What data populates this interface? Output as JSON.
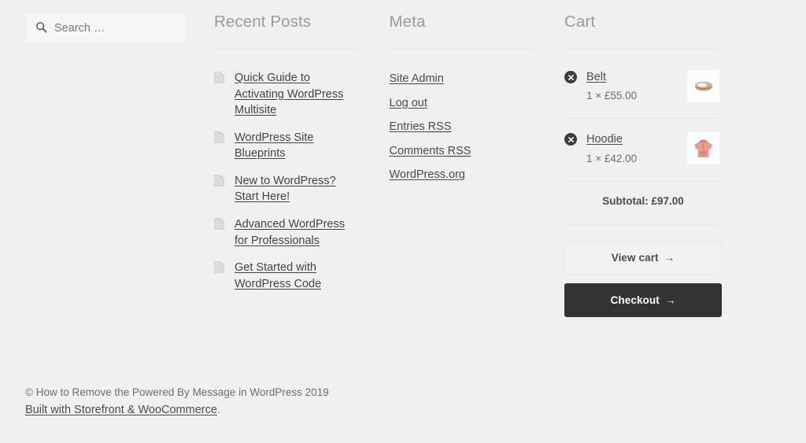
{
  "search": {
    "placeholder": "Search …",
    "value": "",
    "icon": "search-icon"
  },
  "columns": {
    "recent_posts": {
      "title": "Recent Posts",
      "items": [
        {
          "label": "Quick Guide to Activating WordPress Multisite",
          "icon": "document-icon"
        },
        {
          "label": "WordPress Site Blueprints",
          "icon": "document-icon"
        },
        {
          "label": "New to WordPress? Start Here!",
          "icon": "document-icon"
        },
        {
          "label": "Advanced WordPress for Professionals",
          "icon": "document-icon"
        },
        {
          "label": "Get Started with WordPress Code",
          "icon": "document-icon"
        }
      ]
    },
    "meta": {
      "title": "Meta",
      "items": [
        {
          "label": "Site Admin",
          "abbr": ""
        },
        {
          "label": "Log out",
          "abbr": ""
        },
        {
          "label": "Entries ",
          "abbr": "RSS"
        },
        {
          "label": "Comments ",
          "abbr": "RSS"
        },
        {
          "label": "WordPress.org",
          "abbr": ""
        }
      ]
    },
    "cart": {
      "title": "Cart",
      "remove_icon": "remove-circle-icon",
      "items": [
        {
          "name": "Belt",
          "quantity_price": "1 × £55.00",
          "thumb": "belt-thumbnail",
          "remove_label": "×"
        },
        {
          "name": "Hoodie",
          "quantity_price": "1 × £42.00",
          "thumb": "hoodie-thumbnail",
          "remove_label": "×"
        }
      ],
      "subtotal_label": "Subtotal: £97.00",
      "view_cart_label": "View cart",
      "checkout_label": "Checkout",
      "arrow": "→"
    }
  },
  "footer": {
    "copyright": "© How to Remove the Powered By Message in WordPress 2019",
    "built_with_link": "Built with Storefront & WooCommerce",
    "built_with_period": "."
  },
  "colors": {
    "page_background": "#f0f0f0",
    "heading": "#9b9b9b",
    "link": "#4b4b4b",
    "checkout_button": "#333333",
    "divider": "#e7e7e7"
  }
}
